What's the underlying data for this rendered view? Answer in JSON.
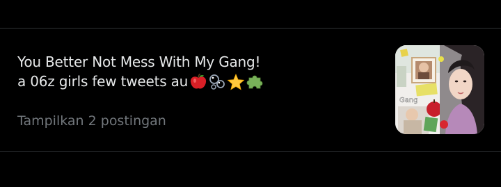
{
  "list": {
    "title_line1": "You Better Not Mess With My Gang!",
    "title_line2": "a 06z girls few tweets au",
    "title_emojis": [
      "apple-emoji",
      "bubbles-emoji",
      "star-emoji",
      "puzzle-piece-emoji"
    ],
    "show_posts_label": "Tampilkan 2 postingan",
    "thumbnail_text": "Gang"
  },
  "colors": {
    "background": "#000000",
    "divider": "#2f3336",
    "title": "#e7e9ea",
    "secondary": "#71767b"
  }
}
